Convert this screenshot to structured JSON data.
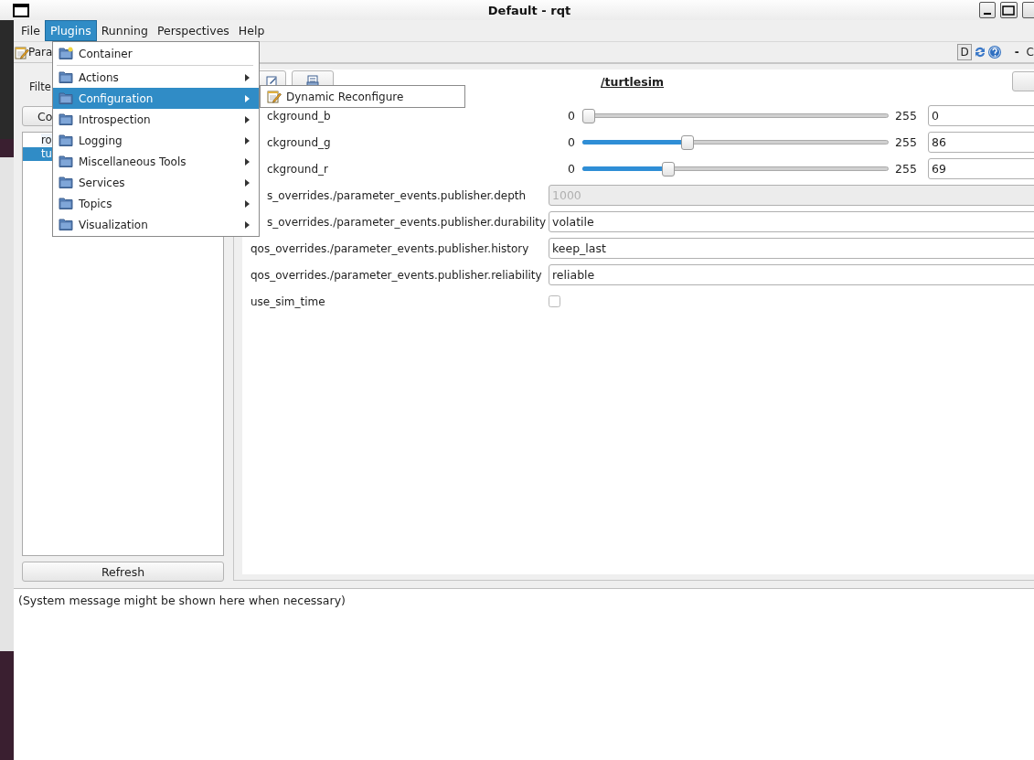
{
  "window": {
    "title": "Default - rqt"
  },
  "menubar": [
    {
      "label": "File",
      "selected": false
    },
    {
      "label": "Plugins",
      "selected": true
    },
    {
      "label": "Running",
      "selected": false
    },
    {
      "label": "Perspectives",
      "selected": false
    },
    {
      "label": "Help",
      "selected": false
    }
  ],
  "plugin_bar": {
    "title": "Para",
    "d_label": "D",
    "dash": "-",
    "trailing_text": "C"
  },
  "node_panel": {
    "filter_label": "Filte",
    "button": "Co",
    "nodes": [
      {
        "label": "ro",
        "selected": false
      },
      {
        "label": "tu",
        "selected": true
      }
    ],
    "refresh": "Refresh"
  },
  "param_panel": {
    "node": "/turtlesim",
    "rows": [
      {
        "kind": "slider",
        "label": "ckground_b",
        "clipped": true,
        "min": "0",
        "max": "255",
        "level": 0,
        "value": "0"
      },
      {
        "kind": "slider",
        "label": "ckground_g",
        "clipped": true,
        "min": "0",
        "max": "255",
        "level": 0.337,
        "value": "86"
      },
      {
        "kind": "slider",
        "label": "ckground_r",
        "clipped": true,
        "min": "0",
        "max": "255",
        "level": 0.27,
        "value": "69"
      },
      {
        "kind": "text",
        "label": "s_overrides./parameter_events.publisher.depth",
        "clipped": true,
        "value": "1000",
        "disabled": true
      },
      {
        "kind": "text",
        "label": "s_overrides./parameter_events.publisher.durability",
        "clipped": true,
        "value": "volatile",
        "disabled": false
      },
      {
        "kind": "text",
        "label": "qos_overrides./parameter_events.publisher.history",
        "value": "keep_last",
        "disabled": false
      },
      {
        "kind": "text",
        "label": "qos_overrides./parameter_events.publisher.reliability",
        "value": "reliable",
        "disabled": false
      },
      {
        "kind": "checkbox",
        "label": "use_sim_time",
        "checked": false
      }
    ]
  },
  "status": {
    "message": "(System message might be shown here when necessary)"
  },
  "plugins_menu": {
    "items": [
      {
        "kind": "plugin",
        "label": "Container",
        "selected": false
      },
      {
        "kind": "group",
        "label": "Actions",
        "selected": false
      },
      {
        "kind": "group",
        "label": "Configuration",
        "selected": true
      },
      {
        "kind": "group",
        "label": "Introspection",
        "selected": false
      },
      {
        "kind": "group",
        "label": "Logging",
        "selected": false
      },
      {
        "kind": "group",
        "label": "Miscellaneous Tools",
        "selected": false
      },
      {
        "kind": "group",
        "label": "Services",
        "selected": false
      },
      {
        "kind": "group",
        "label": "Topics",
        "selected": false
      },
      {
        "kind": "group",
        "label": "Visualization",
        "selected": false
      }
    ]
  },
  "submenu": {
    "items": [
      {
        "kind": "plugin",
        "label": "Dynamic Reconfigure",
        "selected": false
      }
    ]
  }
}
